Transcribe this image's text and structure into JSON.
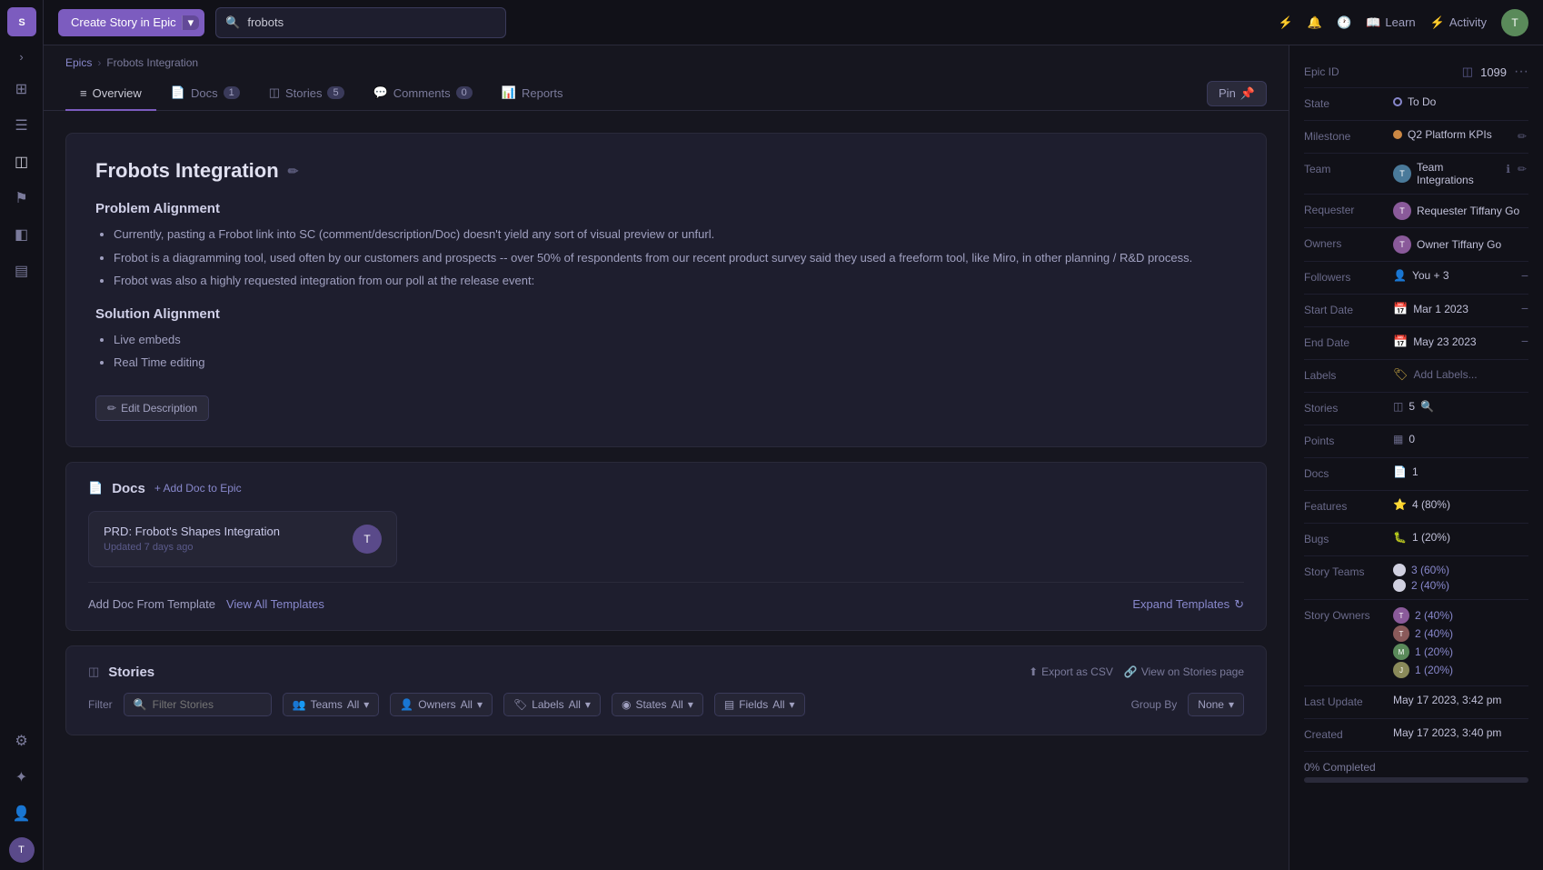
{
  "app": {
    "logo": "S"
  },
  "topbar": {
    "create_button": "Create Story in Epic",
    "search_placeholder": "frobots",
    "learn_label": "Learn",
    "activity_label": "Activity"
  },
  "breadcrumb": {
    "parent": "Epics",
    "current": "Frobots Integration"
  },
  "tabs": [
    {
      "label": "Overview",
      "active": true,
      "count": null
    },
    {
      "label": "Docs",
      "active": false,
      "count": "1"
    },
    {
      "label": "Stories",
      "active": false,
      "count": "5"
    },
    {
      "label": "Comments",
      "active": false,
      "count": "0"
    },
    {
      "label": "Reports",
      "active": false,
      "count": null
    }
  ],
  "pin_button": "Pin",
  "epic": {
    "title": "Frobots Integration",
    "problem_alignment_heading": "Problem Alignment",
    "problem_bullets": [
      "Currently, pasting a Frobot link into SC (comment/description/Doc) doesn't yield any sort of visual preview or unfurl.",
      "Frobot is a diagramming tool, used often by our customers and prospects -- over 50% of respondents from our recent product survey said they used a freeform tool, like Miro, in other planning / R&D process.",
      "Frobot was also a highly requested integration from our poll at the release event:"
    ],
    "solution_alignment_heading": "Solution Alignment",
    "solution_bullets": [
      "Live embeds",
      "Real Time editing"
    ],
    "edit_description_label": "Edit Description"
  },
  "docs_section": {
    "title": "Docs",
    "add_doc_label": "+ Add Doc to Epic",
    "doc_item": {
      "title": "PRD: Frobot's Shapes Integration",
      "updated": "Updated 7 days ago"
    },
    "template_label": "Add Doc From Template",
    "view_all_label": "View All Templates",
    "expand_label": "Expand Templates"
  },
  "stories_section": {
    "title": "Stories",
    "export_label": "Export as CSV",
    "view_on_stories_label": "View on Stories page",
    "filter_label": "Filter",
    "filter_placeholder": "Filter Stories",
    "teams_label": "Teams",
    "owners_label": "Owners",
    "labels_label": "Labels",
    "states_label": "States",
    "fields_label": "Fields",
    "group_by_label": "Group By",
    "group_by_value": "None",
    "all_label": "All"
  },
  "right_sidebar": {
    "epic_id_label": "Epic ID",
    "epic_id_value": "1099",
    "state_label": "State",
    "state_value": "To Do",
    "milestone_label": "Milestone",
    "milestone_value": "Q2 Platform KPIs",
    "team_label": "Team",
    "team_value": "Team Integrations",
    "requester_label": "Requester",
    "requester_value": "Requester Tiffany Go",
    "owners_label": "Owners",
    "owners_value": "Owner Tiffany Go",
    "followers_label": "Followers",
    "followers_value": "You + 3",
    "start_date_label": "Start Date",
    "start_date_value": "Mar 1 2023",
    "end_date_label": "End Date",
    "end_date_value": "May 23 2023",
    "labels_label": "Labels",
    "labels_value": "Add Labels...",
    "stories_label": "Stories",
    "stories_value": "5",
    "points_label": "Points",
    "points_value": "0",
    "docs_label": "Docs",
    "docs_value": "1",
    "features_label": "Features",
    "features_value": "4 (80%)",
    "bugs_label": "Bugs",
    "bugs_value": "1 (20%)",
    "story_teams_label": "Story Teams",
    "story_teams": [
      {
        "percent": "3 (60%)"
      },
      {
        "percent": "2 (40%)"
      }
    ],
    "story_owners_label": "Story Owners",
    "story_owners": [
      {
        "percent": "2 (40%)"
      },
      {
        "percent": "2 (40%)"
      },
      {
        "percent": "1 (20%)"
      },
      {
        "percent": "1 (20%)"
      }
    ],
    "last_update_label": "Last Update",
    "last_update_value": "May 17 2023, 3:42 pm",
    "created_label": "Created",
    "created_value": "May 17 2023, 3:40 pm",
    "progress_label": "0% Completed"
  },
  "sidebar_icons": [
    {
      "name": "home-icon",
      "symbol": "⊞"
    },
    {
      "name": "list-icon",
      "symbol": "☰"
    },
    {
      "name": "stories-icon",
      "symbol": "◫"
    },
    {
      "name": "flag-icon",
      "symbol": "⚑"
    },
    {
      "name": "layers-icon",
      "symbol": "◧"
    },
    {
      "name": "chart-icon",
      "symbol": "▦"
    },
    {
      "name": "user-settings-icon",
      "symbol": "⚙"
    },
    {
      "name": "star-icon",
      "symbol": "✦"
    },
    {
      "name": "people-icon",
      "symbol": "👥"
    }
  ]
}
